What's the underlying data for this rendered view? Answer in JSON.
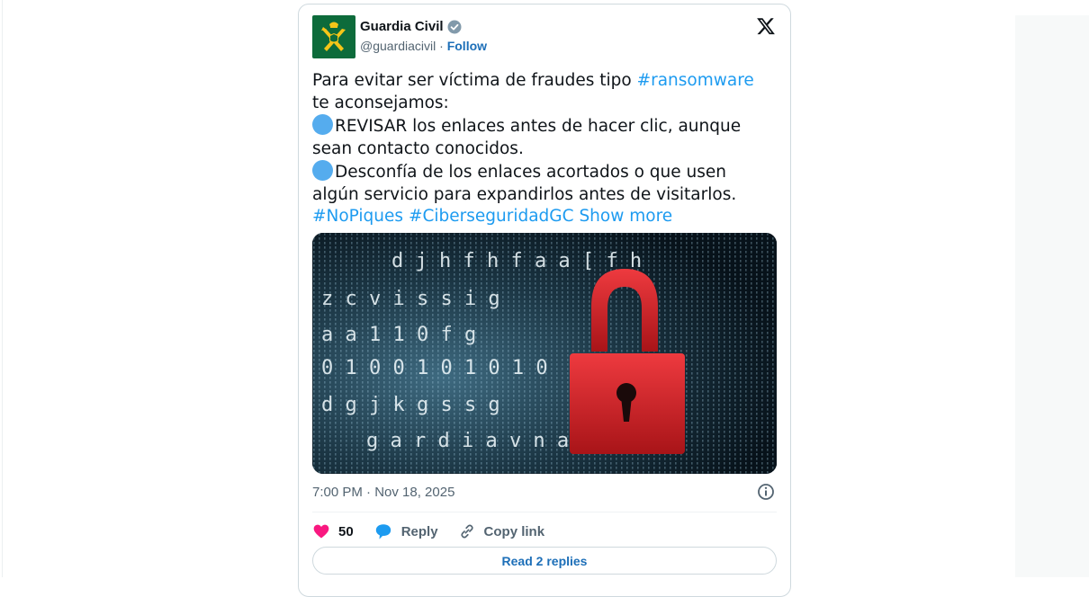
{
  "account": {
    "name": "Guardia Civil",
    "handle": "@guardiacivil",
    "separator": " · ",
    "follow_label": "Follow"
  },
  "tweet": {
    "line1_prefix": "Para evitar ser víctima de fraudes tipo ",
    "hashtag_ransomware": "#ransomware",
    "line1_suffix": " te aconsejamos:",
    "bullet1": "REVISAR los enlaces antes de hacer clic, aunque sean contacto conocidos.",
    "bullet2": "Desconfía de los enlaces acortados o que usen algún servicio para expandirlos antes de visitarlos.",
    "hashtag_nopiques": "#NoPiques",
    "hashtag_ciber": "#CiberseguridadGC",
    "show_more": "Show more"
  },
  "media": {
    "letters": [
      "d j h f h f   a a [ f h",
      "z   c v   i   s   s i g",
      "a     a   1 1 0 f     g",
      "0 1 0       0 1 0 1 0 1 0",
      "d g j k g   s   s   g",
      "g a r d i a v n   a v h"
    ]
  },
  "timestamp": "7:00 PM · Nov 18, 2025",
  "actions": {
    "like_count": "50",
    "reply_label": "Reply",
    "copy_label": "Copy link"
  },
  "read_replies_label": "Read 2 replies",
  "colors": {
    "accent": "#1d9bf0",
    "link_dark": "#1d6fb8",
    "heart": "#f91880",
    "lock_red": "#d8242b",
    "avatar_green": "#0d6b3b"
  }
}
